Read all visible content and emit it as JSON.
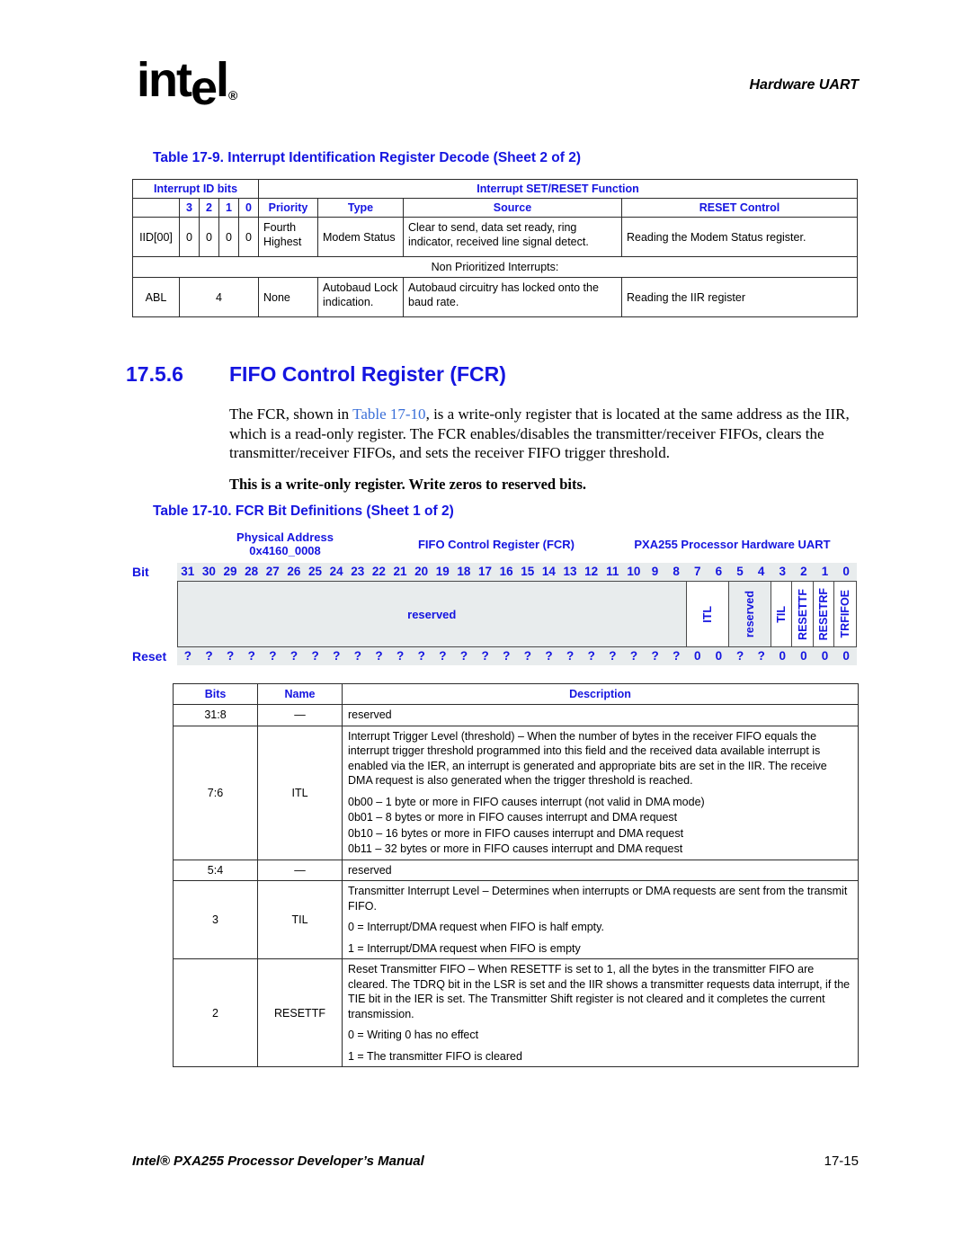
{
  "header": {
    "logo_text": "intel",
    "logo_reg": "®",
    "running_head": "Hardware UART"
  },
  "table_17_9": {
    "title": "Table 17-9. Interrupt Identification Register Decode (Sheet 2 of 2)",
    "group_headers": {
      "interrupt_id_bits": "Interrupt ID bits",
      "interrupt_set_reset_function": "Interrupt SET/RESET Function"
    },
    "columns": {
      "id": "",
      "b3": "3",
      "b2": "2",
      "b1": "1",
      "b0": "0",
      "priority": "Priority",
      "type": "Type",
      "source": "Source",
      "reset_control": "RESET Control"
    },
    "rows": [
      {
        "id": "IID[00]",
        "b3": "0",
        "b2": "0",
        "b1": "0",
        "b0": "0",
        "priority": "Fourth Highest",
        "type": "Modem Status",
        "source": "Clear to send, data set ready, ring indicator, received line signal detect.",
        "reset_control": "Reading the Modem Status register."
      }
    ],
    "separator_row": "Non Prioritized Interrupts:",
    "rows_after": [
      {
        "id": "ABL",
        "bits": "4",
        "priority": "None",
        "type": "Autobaud Lock indication.",
        "source": "Autobaud circuitry has locked onto the baud rate.",
        "reset_control": "Reading the IIR register"
      }
    ]
  },
  "section": {
    "number": "17.5.6",
    "title": "FIFO Control Register (FCR)",
    "paragraph_parts": {
      "p1": "The FCR, shown in ",
      "xref": "Table 17-10",
      "p2": ", is a write-only register that is located at the same address as the IIR, which is a read-only register. The FCR enables/disables the transmitter/receiver FIFOs, clears the transmitter/receiver FIFOs, and sets the receiver FIFO trigger threshold."
    },
    "note": "This is a write-only register. Write zeros to reserved bits."
  },
  "table_17_10": {
    "title": "Table 17-10. FCR Bit Definitions (Sheet 1 of 2)",
    "register_diagram": {
      "physical_address_label": "Physical Address",
      "physical_address_value": "0x4160_0008",
      "register_name": "FIFO Control Register (FCR)",
      "device_name": "PXA255 Processor Hardware UART",
      "bit_label": "Bit",
      "reset_label": "Reset",
      "bit_numbers": [
        "31",
        "30",
        "29",
        "28",
        "27",
        "26",
        "25",
        "24",
        "23",
        "22",
        "21",
        "20",
        "19",
        "18",
        "17",
        "16",
        "15",
        "14",
        "13",
        "12",
        "11",
        "10",
        "9",
        "8",
        "7",
        "6",
        "5",
        "4",
        "3",
        "2",
        "1",
        "0"
      ],
      "reset_values": [
        "?",
        "?",
        "?",
        "?",
        "?",
        "?",
        "?",
        "?",
        "?",
        "?",
        "?",
        "?",
        "?",
        "?",
        "?",
        "?",
        "?",
        "?",
        "?",
        "?",
        "?",
        "?",
        "?",
        "?",
        "0",
        "0",
        "?",
        "?",
        "0",
        "0",
        "0",
        "0"
      ],
      "fields": [
        {
          "name": "reserved",
          "span": 24,
          "orientation": "horizontal",
          "shaded": true
        },
        {
          "name": "ITL",
          "span": 2,
          "orientation": "vertical",
          "shaded": false
        },
        {
          "name": "reserved",
          "span": 2,
          "orientation": "vertical",
          "shaded": true
        },
        {
          "name": "TIL",
          "span": 1,
          "orientation": "vertical",
          "shaded": false
        },
        {
          "name": "RESETTF",
          "span": 1,
          "orientation": "vertical",
          "shaded": false
        },
        {
          "name": "RESETRF",
          "span": 1,
          "orientation": "vertical",
          "shaded": false
        },
        {
          "name": "TRFIFOE",
          "span": 1,
          "orientation": "vertical",
          "shaded": false
        }
      ]
    },
    "columns": {
      "bits": "Bits",
      "name": "Name",
      "description": "Description"
    },
    "rows": [
      {
        "bits": "31:8",
        "name": "—",
        "description": [
          "reserved"
        ]
      },
      {
        "bits": "7:6",
        "name": "ITL",
        "description": [
          "Interrupt Trigger Level (threshold) – When the number of bytes in the receiver FIFO equals the interrupt trigger threshold programmed into this field and the received data available interrupt is enabled via the IER, an interrupt is generated and appropriate bits are set in the IIR. The receive DMA request is also generated when the trigger threshold is reached.",
          "0b00 – 1 byte or more in FIFO causes interrupt (not valid in DMA mode)",
          "0b01 – 8 bytes or more in FIFO causes interrupt and DMA request",
          "0b10 – 16 bytes or more in FIFO causes interrupt and DMA request",
          "0b11 – 32 bytes or more in FIFO causes interrupt and DMA request"
        ]
      },
      {
        "bits": "5:4",
        "name": "—",
        "description": [
          "reserved"
        ]
      },
      {
        "bits": "3",
        "name": "TIL",
        "description": [
          "Transmitter Interrupt Level – Determines when interrupts or DMA requests are sent from the transmit FIFO.",
          "0 =   Interrupt/DMA request when FIFO is half empty.",
          "1 =   Interrupt/DMA request when FIFO is empty"
        ]
      },
      {
        "bits": "2",
        "name": "RESETTF",
        "description": [
          "Reset Transmitter FIFO – When RESETTF is set to 1, all the bytes in the transmitter FIFO are cleared. The TDRQ bit in the LSR is set and the IIR shows a transmitter requests data interrupt, if the TIE bit in the IER is set. The Transmitter Shift register is not cleared and it completes the current transmission.",
          "0 =   Writing 0 has no effect",
          "1 =   The transmitter FIFO is cleared"
        ]
      }
    ]
  },
  "footer": {
    "manual_title": "Intel® PXA255 Processor Developer’s Manual",
    "page_number": "17-15"
  },
  "colors": {
    "heading_blue": "#1515e0",
    "xref_blue": "#3a6fd8",
    "shade": "#e8eced",
    "rule": "#2b2b2b"
  }
}
